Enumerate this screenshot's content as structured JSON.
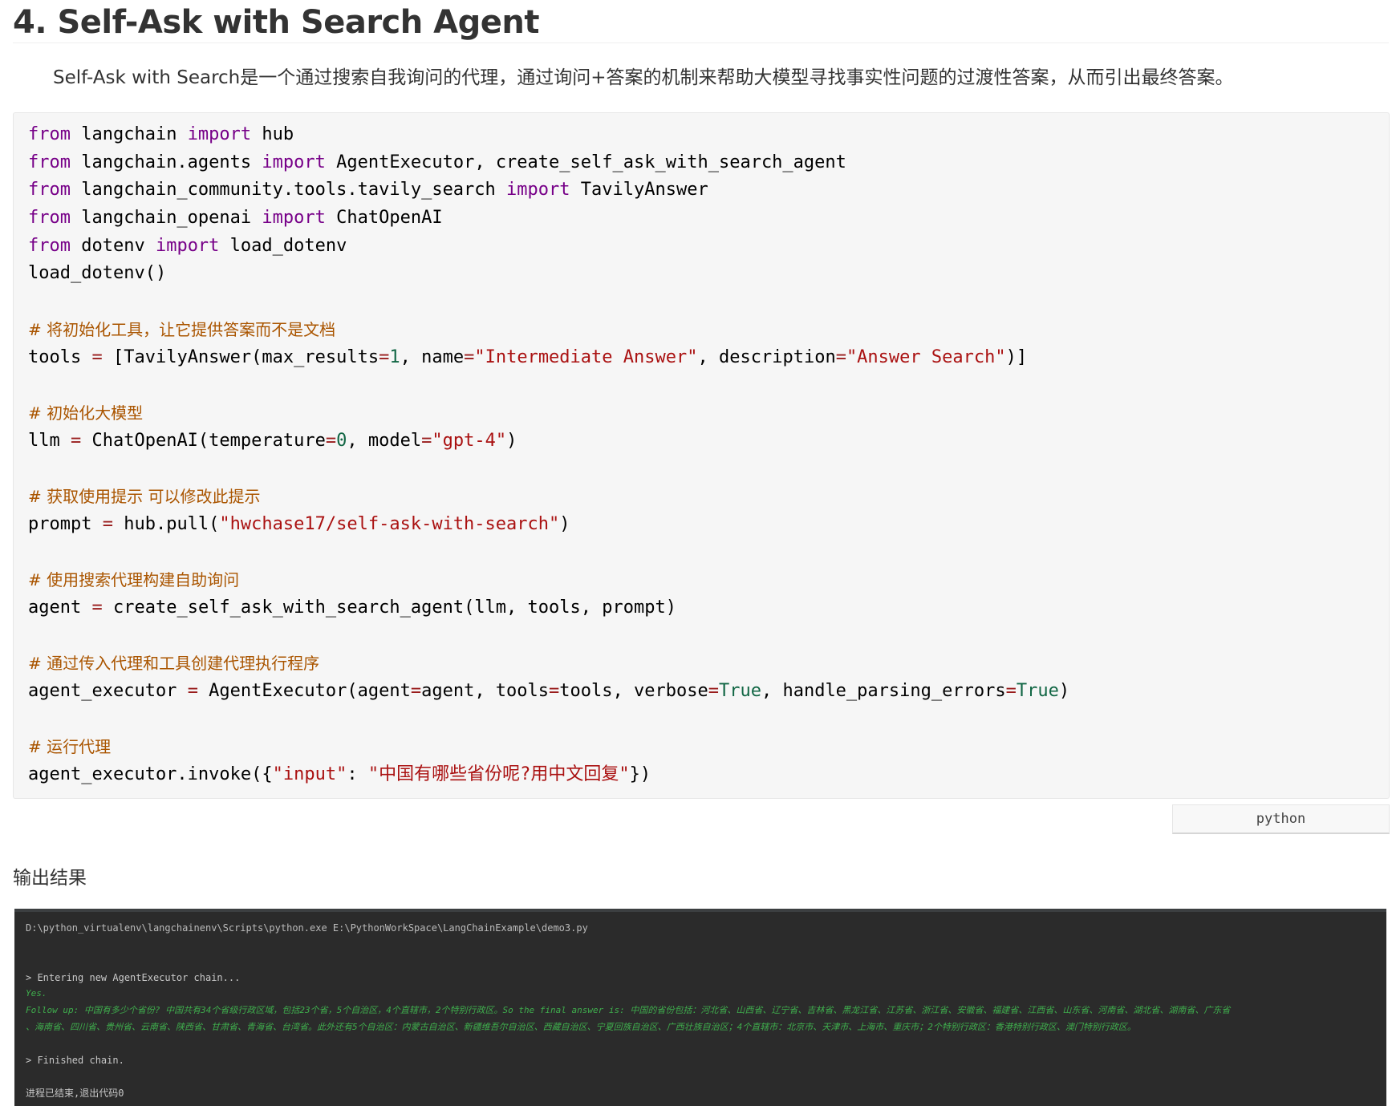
{
  "heading": "4. Self-Ask with Search Agent",
  "intro": "Self-Ask with Search是一个通过搜索自我询问的代理，通过询问+答案的机制来帮助大模型寻找事实性问题的过渡性答案，从而引出最终答案。",
  "code": {
    "lines": [
      [
        {
          "t": "from",
          "c": "kw"
        },
        {
          "t": " langchain "
        },
        {
          "t": "import",
          "c": "kw"
        },
        {
          "t": " hub"
        }
      ],
      [
        {
          "t": "from",
          "c": "kw"
        },
        {
          "t": " langchain.agents "
        },
        {
          "t": "import",
          "c": "kw"
        },
        {
          "t": " AgentExecutor, create_self_ask_with_search_agent"
        }
      ],
      [
        {
          "t": "from",
          "c": "kw"
        },
        {
          "t": " langchain_community.tools.tavily_search "
        },
        {
          "t": "import",
          "c": "kw"
        },
        {
          "t": " TavilyAnswer"
        }
      ],
      [
        {
          "t": "from",
          "c": "kw"
        },
        {
          "t": " langchain_openai "
        },
        {
          "t": "import",
          "c": "kw"
        },
        {
          "t": " ChatOpenAI"
        }
      ],
      [
        {
          "t": "from",
          "c": "kw"
        },
        {
          "t": " dotenv "
        },
        {
          "t": "import",
          "c": "kw"
        },
        {
          "t": " load_dotenv"
        }
      ],
      [
        {
          "t": "load_dotenv()"
        }
      ],
      [],
      [
        {
          "t": "# 将初始化工具，让它提供答案而不是文档",
          "c": "cm"
        }
      ],
      [
        {
          "t": "tools "
        },
        {
          "t": "=",
          "c": "op"
        },
        {
          "t": " [TavilyAnswer(max_results"
        },
        {
          "t": "=",
          "c": "op"
        },
        {
          "t": "1",
          "c": "num"
        },
        {
          "t": ", name"
        },
        {
          "t": "=",
          "c": "op"
        },
        {
          "t": "\"Intermediate Answer\"",
          "c": "str"
        },
        {
          "t": ", description"
        },
        {
          "t": "=",
          "c": "op"
        },
        {
          "t": "\"Answer Search\"",
          "c": "str"
        },
        {
          "t": ")]"
        }
      ],
      [],
      [
        {
          "t": "# 初始化大模型",
          "c": "cm"
        }
      ],
      [
        {
          "t": "llm "
        },
        {
          "t": "=",
          "c": "op"
        },
        {
          "t": " ChatOpenAI(temperature"
        },
        {
          "t": "=",
          "c": "op"
        },
        {
          "t": "0",
          "c": "num"
        },
        {
          "t": ", model"
        },
        {
          "t": "=",
          "c": "op"
        },
        {
          "t": "\"gpt-4\"",
          "c": "str"
        },
        {
          "t": ")"
        }
      ],
      [],
      [
        {
          "t": "# 获取使用提示 可以修改此提示",
          "c": "cm"
        }
      ],
      [
        {
          "t": "prompt "
        },
        {
          "t": "=",
          "c": "op"
        },
        {
          "t": " hub.pull("
        },
        {
          "t": "\"hwchase17/self-ask-with-search\"",
          "c": "str"
        },
        {
          "t": ")"
        }
      ],
      [],
      [
        {
          "t": "# 使用搜索代理构建自助询问",
          "c": "cm"
        }
      ],
      [
        {
          "t": "agent "
        },
        {
          "t": "=",
          "c": "op"
        },
        {
          "t": " create_self_ask_with_search_agent(llm, tools, prompt)"
        }
      ],
      [],
      [
        {
          "t": "# 通过传入代理和工具创建代理执行程序",
          "c": "cm"
        }
      ],
      [
        {
          "t": "agent_executor "
        },
        {
          "t": "=",
          "c": "op"
        },
        {
          "t": " AgentExecutor(agent"
        },
        {
          "t": "=",
          "c": "op"
        },
        {
          "t": "agent, tools"
        },
        {
          "t": "=",
          "c": "op"
        },
        {
          "t": "tools, verbose"
        },
        {
          "t": "=",
          "c": "op"
        },
        {
          "t": "True",
          "c": "num"
        },
        {
          "t": ", handle_parsing_errors"
        },
        {
          "t": "=",
          "c": "op"
        },
        {
          "t": "True",
          "c": "num"
        },
        {
          "t": ")"
        }
      ],
      [],
      [
        {
          "t": "# 运行代理",
          "c": "cm"
        }
      ],
      [
        {
          "t": "agent_executor.invoke({"
        },
        {
          "t": "\"input\"",
          "c": "str"
        },
        {
          "t": ": "
        },
        {
          "t": "\"中国有哪些省份呢?用中文回复\"",
          "c": "str"
        },
        {
          "t": "})"
        }
      ]
    ]
  },
  "language_badge": "python",
  "output_label": "输出结果",
  "terminal": {
    "lines": [
      {
        "text": "D:\\python_virtualenv\\langchainenv\\Scripts\\python.exe E:\\PythonWorkSpace\\LangChainExample\\demo3.py",
        "style": "dim"
      },
      {
        "text": "",
        "style": "blank"
      },
      {
        "text": "",
        "style": "blank"
      },
      {
        "text": "> Entering new AgentExecutor chain...",
        "style": ""
      },
      {
        "text": "Yes.",
        "style": "green"
      },
      {
        "text": "Follow up: 中国有多少个省份? 中国共有34个省级行政区域，包括23个省，5个自治区，4个直辖市，2个特别行政区。So the final answer is: 中国的省份包括：河北省、山西省、辽宁省、吉林省、黑龙江省、江苏省、浙江省、安徽省、福建省、江西省、山东省、河南省、湖北省、湖南省、广东省",
        "style": "green"
      },
      {
        "text": "、海南省、四川省、贵州省、云南省、陕西省、甘肃省、青海省、台湾省。此外还有5个自治区：内蒙古自治区、新疆维吾尔自治区、西藏自治区、宁夏回族自治区、广西壮族自治区；4个直辖市：北京市、天津市、上海市、重庆市；2个特别行政区：香港特别行政区、澳门特别行政区。",
        "style": "green"
      },
      {
        "text": "",
        "style": "blank"
      },
      {
        "text": "> Finished chain.",
        "style": ""
      },
      {
        "text": "",
        "style": "blank"
      },
      {
        "text": "进程已结束,退出代码0",
        "style": ""
      }
    ]
  }
}
